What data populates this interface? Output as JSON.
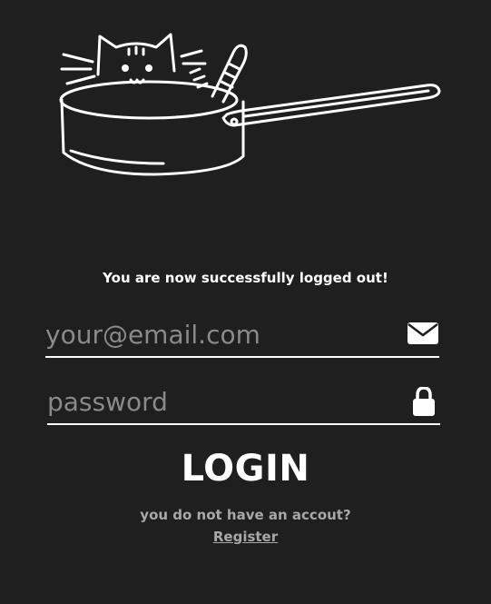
{
  "logo": {
    "icon": "cat-in-pan-icon"
  },
  "status": {
    "message": "You are now successfully logged out!"
  },
  "form": {
    "email_placeholder": "your@email.com",
    "email_icon": "envelope-icon",
    "password_placeholder": "password",
    "password_icon": "lock-icon",
    "login_label": "LOGIN"
  },
  "register": {
    "prompt": "you do not have an accout?",
    "link_label": "Register"
  },
  "colors": {
    "background": "#1f1f1f",
    "foreground": "#ffffff",
    "muted": "#a8a8a8",
    "placeholder": "#8a8a8a"
  }
}
